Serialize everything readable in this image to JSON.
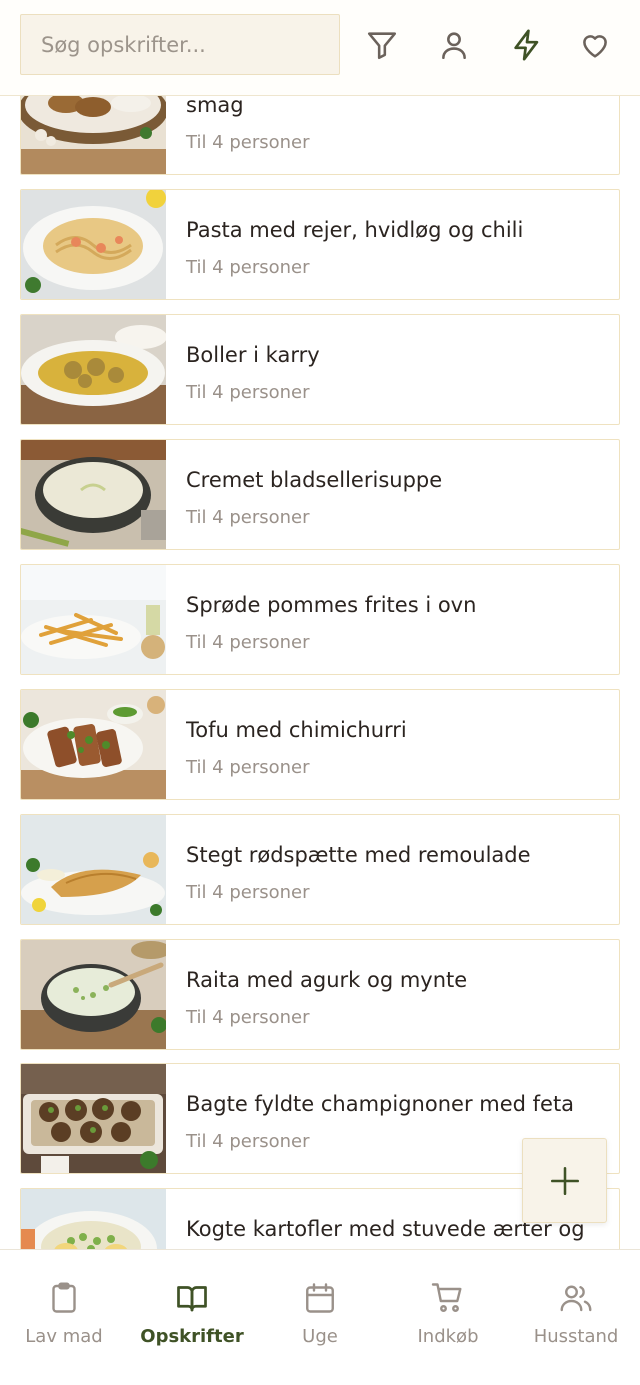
{
  "header": {
    "search_placeholder": "Søg opskrifter...",
    "icons": [
      "filter-icon",
      "user-icon",
      "lightning-icon",
      "heart-icon"
    ],
    "accent_color": "#3f5226"
  },
  "recipes": [
    {
      "title": "smag",
      "sub": "Til 4 personer"
    },
    {
      "title": "Pasta med rejer, hvidløg og chili",
      "sub": "Til 4 personer"
    },
    {
      "title": "Boller i karry",
      "sub": "Til 4 personer"
    },
    {
      "title": "Cremet bladsellerisuppe",
      "sub": "Til 4 personer"
    },
    {
      "title": "Sprøde pommes frites i ovn",
      "sub": "Til 4 personer"
    },
    {
      "title": "Tofu med chimichurri",
      "sub": "Til 4 personer"
    },
    {
      "title": "Stegt rødspætte med remoulade",
      "sub": "Til 4 personer"
    },
    {
      "title": "Raita med agurk og mynte",
      "sub": "Til 4 personer"
    },
    {
      "title": "Bagte fyldte champignoner med feta",
      "sub": "Til 4 personer"
    },
    {
      "title": "Kogte kartofler med stuvede ærter og",
      "sub": ""
    }
  ],
  "fab": {
    "icon": "plus-icon"
  },
  "nav": {
    "items": [
      {
        "label": "Lav mad",
        "icon": "clipboard-icon"
      },
      {
        "label": "Opskrifter",
        "icon": "book-icon"
      },
      {
        "label": "Uge",
        "icon": "calendar-icon"
      },
      {
        "label": "Indkøb",
        "icon": "cart-icon"
      },
      {
        "label": "Husstand",
        "icon": "users-icon"
      }
    ],
    "active": "Opskrifter"
  }
}
